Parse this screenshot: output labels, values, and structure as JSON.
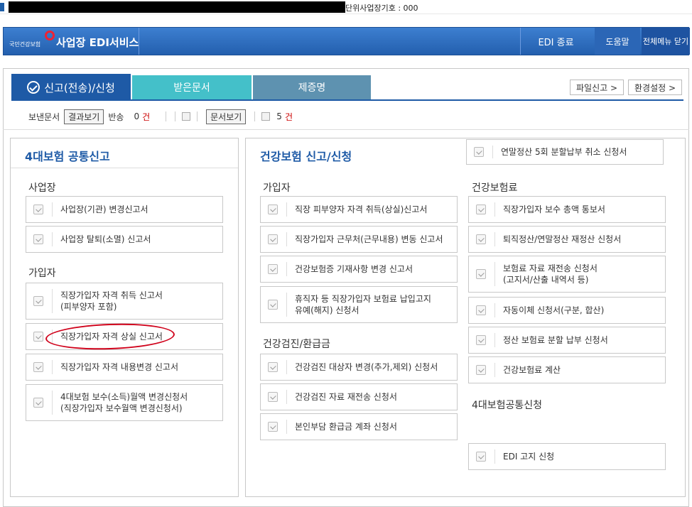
{
  "topbar": {
    "code_text": "단위사업장기호 : 000"
  },
  "header": {
    "logo_text": "국민건강보험",
    "site_title": "사업장 EDI서비스",
    "buttons": [
      "EDI 종료",
      "도움말",
      "전체메뉴 닫기"
    ]
  },
  "tabs": {
    "active": "신고(전송)/신청",
    "received": "받은문서",
    "certificate": "제증명"
  },
  "right_buttons": [
    "파일신고 >",
    "환경설정 >"
  ],
  "toolbar": {
    "sent_label": "보낸문서",
    "result_button": "결과보기",
    "return_label": "반송",
    "return_count": "0",
    "unit": "건",
    "doc_button": "문서보기",
    "doc_count": "5"
  },
  "left": {
    "title": "4대보험 공통신고",
    "sections": [
      {
        "title": "사업장",
        "items": [
          "사업장(기관) 변경신고서",
          "사업장 탈퇴(소멸) 신고서"
        ]
      },
      {
        "title": "가입자",
        "items": [
          "직장가입자 자격 취득 신고서\n(피부양자 포함)",
          "직장가입자 자격 상실 신고서",
          "직장가입자 자격 내용변경 신고서",
          "4대보험 보수(소득)월액 변경신청서\n(직장가입자 보수월액 변경신청서)"
        ]
      }
    ]
  },
  "right": {
    "title": "건강보험 신고/신청",
    "notice_item": "연말정산 5회 분할납부 취소 신청서",
    "col1": [
      {
        "title": "가입자",
        "items": [
          "직장 피부양자 자격 취득(상실)신고서",
          "직장가입자 근무처(근무내용) 변동 신고서",
          "건강보험증 기재사항 변경 신고서",
          "휴직자 등 직장가입자 보험료 납입고지\n유예(해지) 신청서"
        ]
      },
      {
        "title": "건강검진/환급금",
        "items": [
          "건강검진 대상자 변경(추가,제외) 신청서",
          "건강검진 자료 재전송 신청서",
          "본인부담 환급금 계좌 신청서"
        ]
      }
    ],
    "col2": [
      {
        "title": "건강보험료",
        "items": [
          "직장가입자 보수 총액 통보서",
          "퇴직정산/연말정산 재정산 신청서",
          "보험료 자료 재전송 신청서\n(고지서/산출 내역서 등)",
          "자동이체 신청서(구분, 합산)",
          "정산 보험료 분할 납부 신청서",
          "건강보험료 계산"
        ]
      },
      {
        "title": "4대보험공통신청",
        "items": [
          "EDI 고지 신청"
        ]
      }
    ]
  },
  "colors": {
    "header_blue": "#235fae",
    "tab_active": "#1e5aa6",
    "tab_teal": "#44c0c9",
    "tab_steel": "#5e92b0",
    "count_red": "#c00000",
    "annotation_red": "#d0021b"
  }
}
